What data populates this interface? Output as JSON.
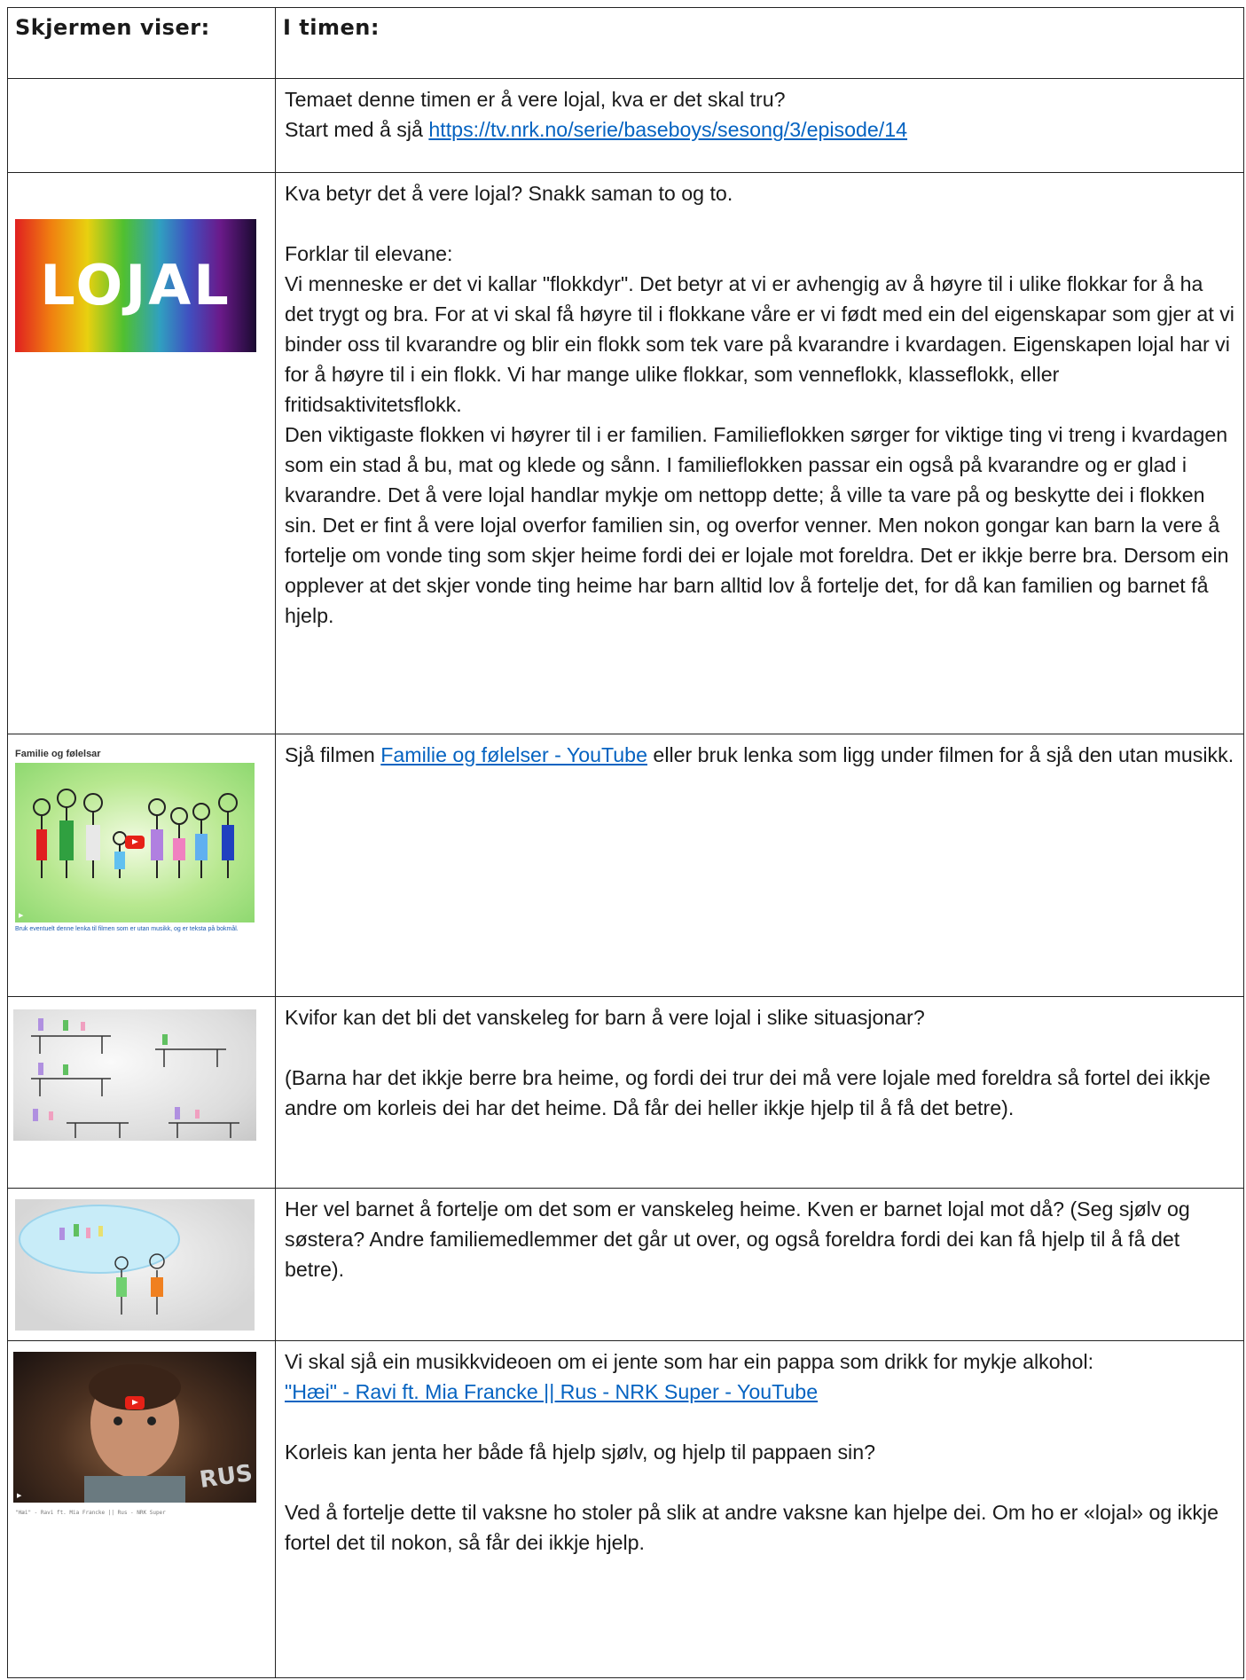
{
  "header": {
    "col1": "Skjermen viser:",
    "col2": "I timen:"
  },
  "rows": [
    {
      "lines": [
        "Temaet denne timen er å vere lojal, kva er det skal tru?"
      ],
      "link_prefix": "Start med å sjå ",
      "link": "https://tv.nrk.no/serie/baseboys/sesong/3/episode/14"
    },
    {
      "image_text": "LOJAL",
      "q": "Kva betyr det å vere lojal? Snakk saman to og to.",
      "intro": "Forklar til elevane:",
      "p1": "Vi menneske er det vi kallar \"flokkdyr\". Det betyr at vi er avhengig av å høyre til i ulike flokkar for å ha det trygt og bra. For at vi skal få høyre til i flokkane våre er vi født med ein del eigenskapar som gjer at vi binder oss til kvarandre og blir ein flokk som tek vare på kvarandre i kvardagen. Eigenskapen lojal har vi for å høyre til i ein flokk. Vi har mange ulike flokkar, som venneflokk, klasseflokk, eller fritidsaktivitetsflokk.",
      "p2": "Den viktigaste flokken vi høyrer til i er familien. Familieflokken sørger for viktige ting vi treng i kvardagen som ein stad å bu, mat og klede og sånn. I familieflokken passar ein også på kvarandre og er glad i kvarandre. Det å vere lojal handlar mykje om nettopp dette; å ville ta vare på og beskytte dei i flokken sin. Det er fint å vere lojal overfor familien sin, og overfor venner. Men nokon gongar kan barn la vere å fortelje om vonde ting som skjer heime fordi dei er lojale mot foreldra. Det er ikkje berre bra. Dersom ein opplever at det skjer vonde ting heime har barn alltid lov å fortelje det, for då kan familien og barnet få hjelp."
    },
    {
      "thumb_title": "Familie og følelsar",
      "thumb_foot": "Bruk eventuelt denne lenka til filmen som er utan musikk, og er teksta på bokmål.",
      "prefix": "Sjå filmen ",
      "link": "Familie og følelser - YouTube",
      "suffix": " eller bruk lenka som ligg under filmen for å sjå den utan musikk."
    },
    {
      "q": "Kvifor kan det bli det vanskeleg for barn å vere lojal i slike situasjonar?",
      "a": "(Barna har det ikkje berre bra heime, og fordi dei trur dei må vere lojale med foreldra så fortel dei ikkje andre om korleis dei har det heime. Då får dei heller ikkje hjelp til å få det betre)."
    },
    {
      "text": "Her vel barnet å fortelje om det som er vanskeleg heime. Kven er barnet lojal mot då? (Seg sjølv og søstera? Andre familiemedlemmer det går ut over, og også foreldra fordi dei kan få hjelp til å få det betre)."
    },
    {
      "thumb_caption": "\"Hæi\" - Ravi ft. Mia Francke || Rus - NRK Super",
      "thumb_logo": "RUS",
      "intro": "Vi skal sjå ein musikkvideoen om ei jente som har ein pappa som drikk for mykje alkohol:",
      "link": "\"Hæi\" - Ravi ft. Mia Francke || Rus - NRK Super - YouTube",
      "q": "Korleis kan jenta her både få hjelp sjølv, og hjelp til pappaen sin?",
      "a": "Ved å fortelje dette til vaksne ho stoler på slik at andre vaksne kan hjelpe dei. Om ho er «lojal» og ikkje fortel det til nokon, så får dei ikkje hjelp."
    }
  ]
}
